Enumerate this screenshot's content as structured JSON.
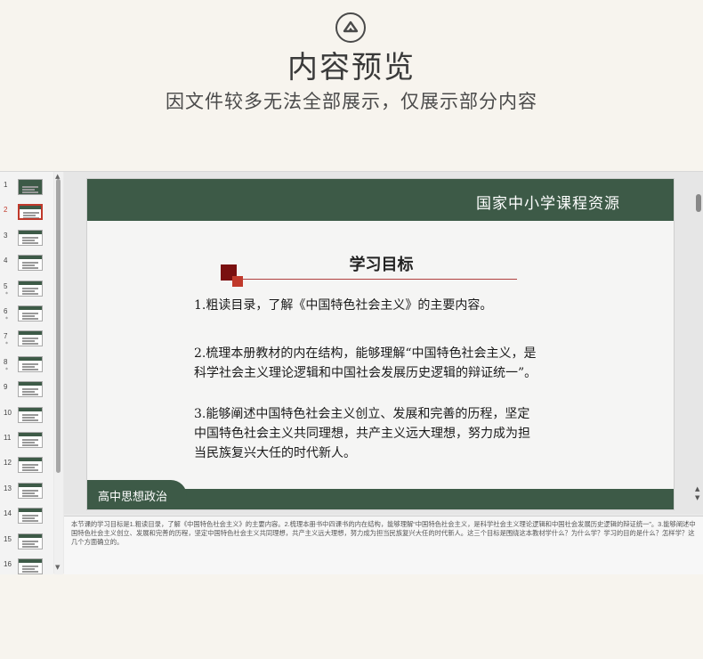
{
  "header": {
    "logo_icon": "mountain-peak-icon",
    "title": "内容预览",
    "subtitle": "因文件较多无法全部展示，仅展示部分内容"
  },
  "thumbnails": [
    {
      "num": "1",
      "star": ""
    },
    {
      "num": "2",
      "star": "",
      "active": true
    },
    {
      "num": "3",
      "star": ""
    },
    {
      "num": "4",
      "star": ""
    },
    {
      "num": "5",
      "star": "*"
    },
    {
      "num": "6",
      "star": "*"
    },
    {
      "num": "7",
      "star": "*"
    },
    {
      "num": "8",
      "star": "*"
    },
    {
      "num": "9",
      "star": ""
    },
    {
      "num": "10",
      "star": ""
    },
    {
      "num": "11",
      "star": ""
    },
    {
      "num": "12",
      "star": ""
    },
    {
      "num": "13",
      "star": ""
    },
    {
      "num": "14",
      "star": ""
    },
    {
      "num": "15",
      "star": ""
    },
    {
      "num": "16",
      "star": ""
    }
  ],
  "slide": {
    "banner": "国家中小学课程资源",
    "heading": "学习目标",
    "objective1": "1.粗读目录，了解《中国特色社会主义》的主要内容。",
    "objective2_line1": "2.梳理本册教材的内在结构，能够理解“中国特色社会主义，是",
    "objective2_line2": "科学社会主义理论逻辑和中国社会发展历史逻辑的辩证统一”。",
    "objective3_line1": "3.能够阐述中国特色社会主义创立、发展和完善的历程，坚定",
    "objective3_line2": "中国特色社会主义共同理想，共产主义远大理想，努力成为担",
    "objective3_line3": "当民族复兴大任的时代新人。",
    "footer": "高中思想政治"
  },
  "notes": {
    "text": "本节课的学习目标是1.粗读目录，了解《中国特色社会主义》的主要内容。2.梳理本册书中四课书的内在结构，能够理解“中国特色社会主义，是科学社会主义理论逻辑和中国社会发展历史逻辑的辩证统一”。3.能够阐述中国特色社会主义创立、发展和完善的历程，坚定中国特色社会主义共同理想，共产主义远大理想，努力成为担当民族复兴大任的时代新人。这三个目标是围绕这本教材学什么？为什么学？学习的目的是什么？怎样学？这几个方面确立的。"
  },
  "colors": {
    "accent_green": "#3d5a47",
    "accent_red": "#c0392b",
    "background": "#f7f4ee"
  }
}
